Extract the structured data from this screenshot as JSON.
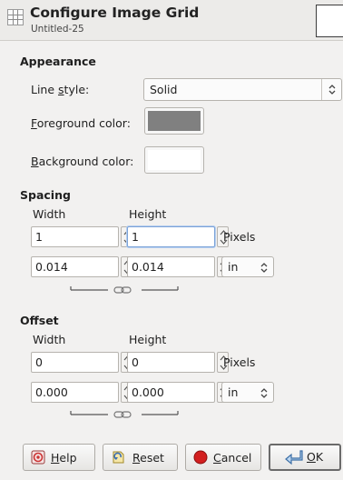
{
  "dialog": {
    "title": "Configure Image Grid",
    "subtitle": "Untitled-25"
  },
  "appearance": {
    "section_title": "Appearance",
    "line_style_label_pre": "Line ",
    "line_style_label_u": "s",
    "line_style_label_post": "tyle:",
    "line_style_value": "Solid",
    "fg_label_u": "F",
    "fg_label_post": "oreground color:",
    "fg_color": "#808080",
    "bg_label_u": "B",
    "bg_label_post": "ackground color:",
    "bg_color": "#ffffff"
  },
  "spacing": {
    "section_title": "Spacing",
    "width_header": "Width",
    "height_header": "Height",
    "width_value": "1",
    "height_value": "1",
    "pixels_label": "Pixels",
    "width_value_units": "0.014",
    "height_value_units": "0.014",
    "unit": "in"
  },
  "offset": {
    "section_title": "Offset",
    "width_header": "Width",
    "height_header": "Height",
    "width_value": "0",
    "height_value": "0",
    "pixels_label": "Pixels",
    "width_value_units": "0.000",
    "height_value_units": "0.000",
    "unit": "in"
  },
  "buttons": {
    "help_u": "H",
    "help_post": "elp",
    "reset_u": "R",
    "reset_post": "eset",
    "cancel_u": "C",
    "cancel_post": "ancel",
    "ok_u": "O",
    "ok_post": "K"
  },
  "icons": {
    "header": "grid-icon",
    "help": "help-icon",
    "reset": "reset-icon",
    "cancel": "cancel-icon",
    "ok": "ok-arrow-icon",
    "chain": "chain-link-icon"
  }
}
